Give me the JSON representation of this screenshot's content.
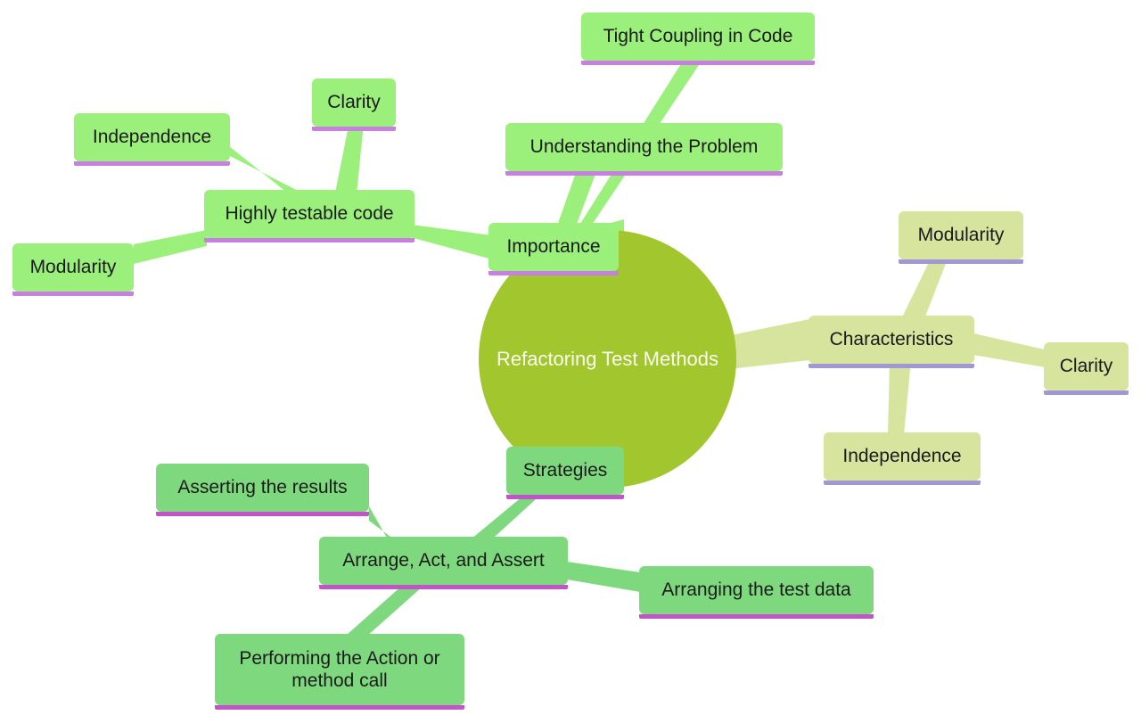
{
  "diagram": {
    "type": "mindmap",
    "title": "Refactoring Test Methods",
    "background": "#ffffff",
    "root": {
      "label": "Refactoring Test Methods",
      "fill": "#a2c62e",
      "text_color": "#fbfbf0"
    },
    "branches": [
      {
        "name": "importance",
        "label": "Importance",
        "fill": "#9bf07c",
        "accent": "#c77fe0",
        "children": [
          {
            "name": "tight-coupling-in-code",
            "label": "Tight Coupling in Code"
          },
          {
            "name": "understanding-the-problem",
            "label": "Understanding the Problem"
          },
          {
            "name": "highly-testable-code",
            "label": "Highly testable code",
            "children": [
              {
                "name": "clarity",
                "label": "Clarity"
              },
              {
                "name": "independence",
                "label": "Independence"
              },
              {
                "name": "modularity",
                "label": "Modularity"
              }
            ]
          }
        ]
      },
      {
        "name": "characteristics",
        "label": "Characteristics",
        "fill": "#d6e49d",
        "accent": "#a297d6",
        "children": [
          {
            "name": "modularity",
            "label": "Modularity"
          },
          {
            "name": "clarity",
            "label": "Clarity"
          },
          {
            "name": "independence",
            "label": "Independence"
          }
        ]
      },
      {
        "name": "strategies",
        "label": "Strategies",
        "fill": "#7ed97e",
        "accent": "#c253c9",
        "children": [
          {
            "name": "arrange-act-and-assert",
            "label": "Arrange, Act, and Assert",
            "children": [
              {
                "name": "asserting-the-results",
                "label": "Asserting the results"
              },
              {
                "name": "arranging-the-test-data",
                "label": "Arranging the test data"
              },
              {
                "name": "performing-the-action-or-method-call",
                "label": "Performing the Action or\nmethod call"
              }
            ]
          }
        ]
      }
    ],
    "nodes": {
      "tight_coupling": "Tight Coupling in Code",
      "understanding_problem": "Understanding the Problem",
      "importance": "Importance",
      "clarity_left": "Clarity",
      "independence_left": "Independence",
      "highly_testable": "Highly testable code",
      "modularity_left": "Modularity",
      "characteristics": "Characteristics",
      "modularity_right": "Modularity",
      "clarity_right": "Clarity",
      "independence_right": "Independence",
      "strategies": "Strategies",
      "asserting_results": "Asserting the results",
      "arrange_act_assert": "Arrange, Act, and Assert",
      "arranging_test_data": "Arranging the test data",
      "performing_action": "Performing the Action or\nmethod call"
    }
  }
}
